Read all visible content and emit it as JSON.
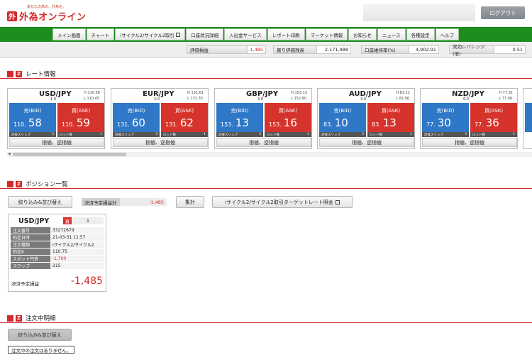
{
  "header": {
    "tagline": "あなたの為の、外為を。",
    "logo_mark": "外",
    "logo_text": "外為オンライン",
    "logout_label": "ログアウト"
  },
  "nav": {
    "items": [
      {
        "label": "メイン画面"
      },
      {
        "label": "チャート"
      },
      {
        "label": "iサイクル2/サイクル2取引"
      },
      {
        "label": "口座状況詳細"
      },
      {
        "label": "入出金サービス"
      },
      {
        "label": "レポート印刷"
      },
      {
        "label": "マーケット情報"
      },
      {
        "label": "お知らせ"
      },
      {
        "label": "ニュース"
      },
      {
        "label": "各種設定"
      },
      {
        "label": "ヘルプ"
      }
    ]
  },
  "summary": {
    "items": [
      {
        "label": "評価損益",
        "value": "-1,485"
      },
      {
        "label": "買り評価残高",
        "value": "2,171,988"
      },
      {
        "label": "口座維持率(%)",
        "value": "4,902.91"
      },
      {
        "label": "実効レバレッジ(倍)",
        "value": "0.51"
      }
    ]
  },
  "sections": {
    "rates_title": "レート情報",
    "positions_title": "ポジション一覧",
    "orders_title": "注文中明細",
    "z_mark": "Z"
  },
  "rates": [
    {
      "pair": "USD/JPY",
      "high": "H 110.58",
      "low": "L 110.45",
      "spread": "1.0",
      "bid_label": "売(BID)",
      "bid_small": "110.",
      "bid_big": "58",
      "ask_label": "買(ASK)",
      "ask_small": "110.",
      "ask_big": "59",
      "slip_label": "許容スリップ",
      "slip_value": "3",
      "lot_label": "ロット数",
      "lot_value": "1",
      "order_label": "指値、逆指値"
    },
    {
      "pair": "EUR/JPY",
      "high": "H 131.61",
      "low": "L 131.35",
      "spread": "2.0",
      "bid_label": "売(BID)",
      "bid_small": "131.",
      "bid_big": "60",
      "ask_label": "買(ASK)",
      "ask_small": "131.",
      "ask_big": "62",
      "slip_label": "許容スリップ",
      "slip_value": "3",
      "lot_label": "ロット数",
      "lot_value": "1",
      "order_label": "指値、逆指値"
    },
    {
      "pair": "GBP/JPY",
      "high": "H 153.13",
      "low": "L 152.80",
      "spread": "3.0",
      "bid_label": "売(BID)",
      "bid_small": "153.",
      "bid_big": "13",
      "ask_label": "買(ASK)",
      "ask_small": "153.",
      "ask_big": "16",
      "slip_label": "許容スリップ",
      "slip_value": "3",
      "lot_label": "ロット数",
      "lot_value": "1",
      "order_label": "指値、逆指値"
    },
    {
      "pair": "AUD/JPY",
      "high": "H 83.11",
      "low": "L 82.96",
      "spread": "3.0",
      "bid_label": "売(BID)",
      "bid_small": "83.",
      "bid_big": "10",
      "ask_label": "買(ASK)",
      "ask_small": "83.",
      "ask_big": "13",
      "slip_label": "許容スリップ",
      "slip_value": "3",
      "lot_label": "ロット数",
      "lot_value": "1",
      "order_label": "指値、逆指値"
    },
    {
      "pair": "NZD/JPY",
      "high": "H 77.31",
      "low": "L 77.06",
      "spread": "6.0",
      "bid_label": "売(BID)",
      "bid_small": "77.",
      "bid_big": "30",
      "ask_label": "買(ASK)",
      "ask_small": "77.",
      "ask_big": "36",
      "slip_label": "許容スリップ",
      "slip_value": "3",
      "lot_label": "ロット数",
      "lot_value": "1",
      "order_label": "指値、逆指値"
    }
  ],
  "positions": {
    "filter_label": "絞り込み&並び替え",
    "pl_label": "決済予定損益計",
    "pl_value": "-1,485",
    "total_label": "集計",
    "target_label": "iサイクル2/サイクル2取引ターゲットレート照会",
    "card": {
      "pair": "USD/JPY",
      "side": "買",
      "qty": "1",
      "rows": [
        {
          "k": "注文番号",
          "v": "33272679"
        },
        {
          "k": "約定日時",
          "v": "21-03-31 11:57"
        },
        {
          "k": "注文種類",
          "v": "iサイクル2/サイクル2"
        },
        {
          "k": "約定R",
          "v": "110.75"
        },
        {
          "k": "スポット円貨",
          "v": "-1,700"
        },
        {
          "k": "スワップ",
          "v": "215"
        }
      ],
      "pl_label": "決済予定損益",
      "pl_value": "-1,485"
    }
  },
  "orders": {
    "filter_label": "絞り込み&並び替え",
    "empty_message": "注文中の注文はありません。"
  },
  "colors": {
    "brand_red": "#d42a2a",
    "nav_green": "#1d8d1d",
    "bid_blue": "#2f78c8",
    "ask_red": "#d6332c"
  }
}
